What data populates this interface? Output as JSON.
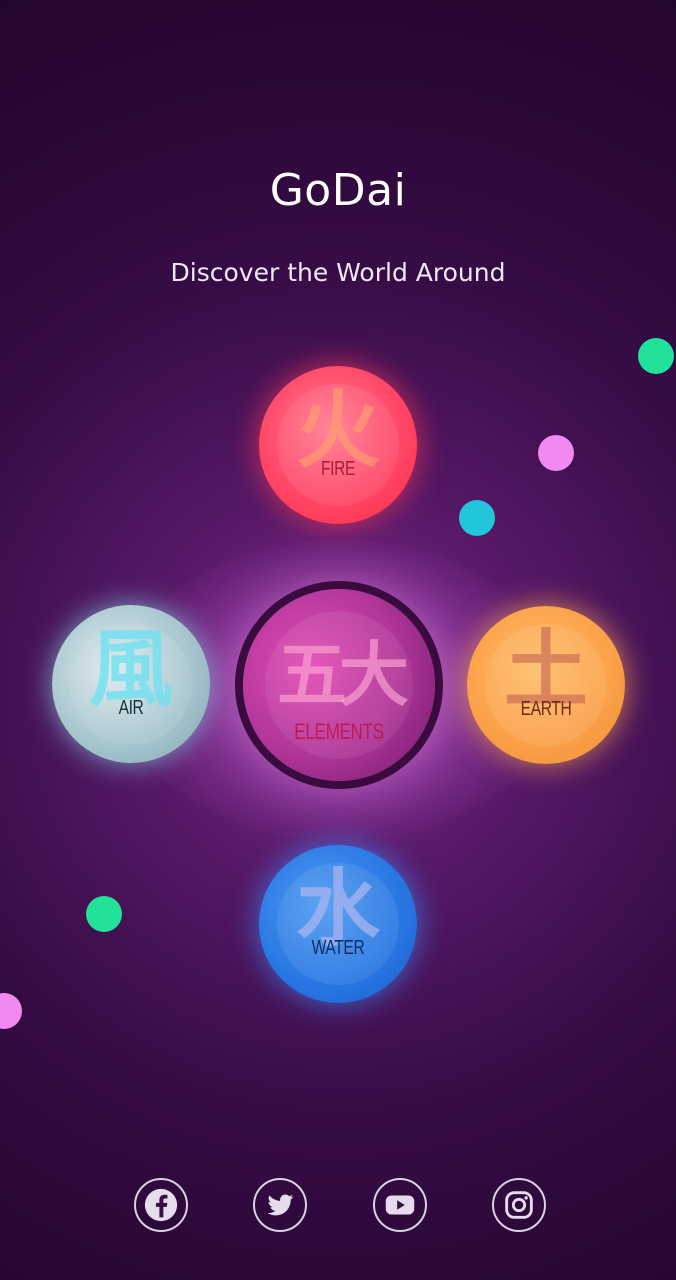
{
  "app": {
    "title": "GoDai",
    "subtitle": "Discover the World Around"
  },
  "elements": {
    "fire": {
      "kanji": "火",
      "label": "FIRE"
    },
    "air": {
      "kanji": "風",
      "label": "AIR"
    },
    "center": {
      "kanji": "五大",
      "label": "ELEMENTS"
    },
    "earth": {
      "kanji": "土",
      "label": "EARTH"
    },
    "water": {
      "kanji": "水",
      "label": "WATER"
    }
  },
  "social": [
    {
      "name": "facebook-icon"
    },
    {
      "name": "twitter-icon"
    },
    {
      "name": "youtube-icon"
    },
    {
      "name": "instagram-icon"
    }
  ],
  "colors": {
    "fire": "#ff4768",
    "air": "#a9c7cf",
    "center": "#b3379a",
    "earth": "#fba24a",
    "water": "#2a78e4",
    "dot_green": "#22e29a",
    "dot_pink": "#f18af0",
    "dot_cyan": "#22c6da"
  }
}
